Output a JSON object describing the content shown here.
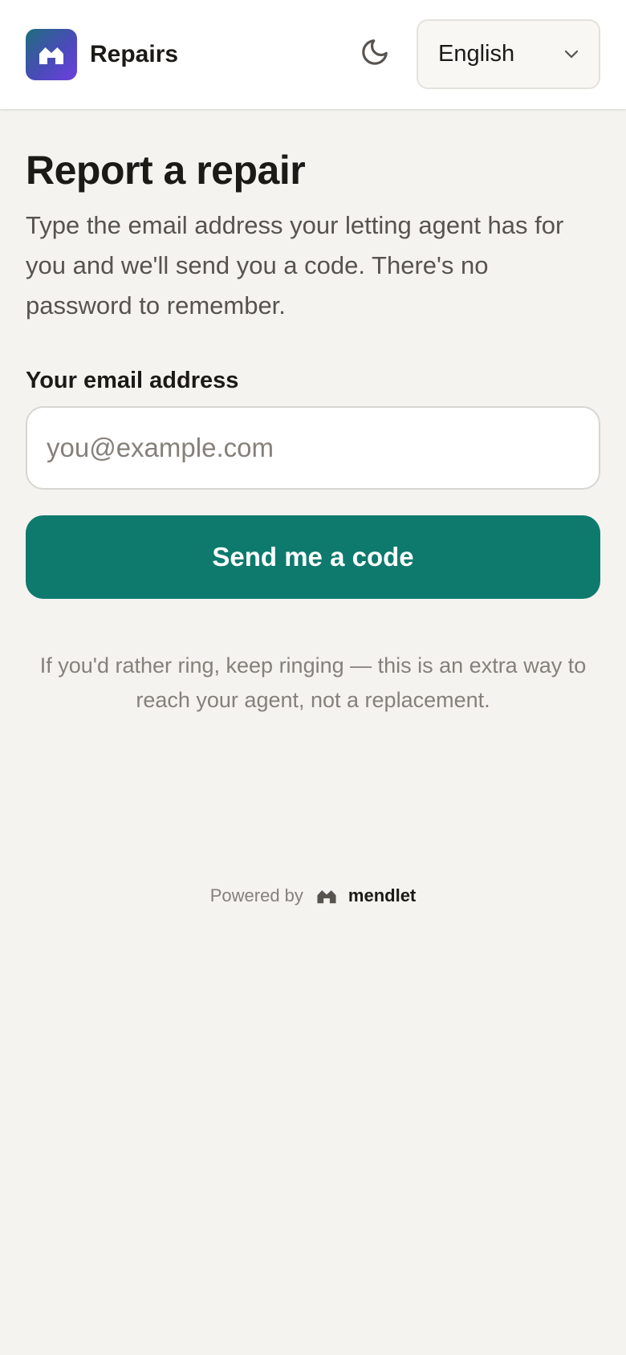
{
  "header": {
    "brand_name": "Repairs",
    "logo_icon": "house-icon",
    "theme_toggle_icon": "moon-icon",
    "language": {
      "selected": "English",
      "icon": "chevron-down-icon"
    }
  },
  "main": {
    "title": "Report a repair",
    "intro": "Type the email address your letting agent has for you and we'll send you a code. There's no password to remember.",
    "email_label": "Your email address",
    "email_placeholder": "you@example.com",
    "email_value": "",
    "submit_label": "Send me a code",
    "note": "If you'd rather ring, keep ringing — this is an extra way to reach your agent, not a replacement."
  },
  "footer": {
    "powered_by": "Powered by",
    "brand": "mendlet",
    "brand_icon": "house-icon"
  },
  "colors": {
    "accent": "#0e7a6e",
    "background": "#f4f3f0",
    "logo_gradient_start": "#1e6e7e",
    "logo_gradient_end": "#6d3fe0"
  }
}
